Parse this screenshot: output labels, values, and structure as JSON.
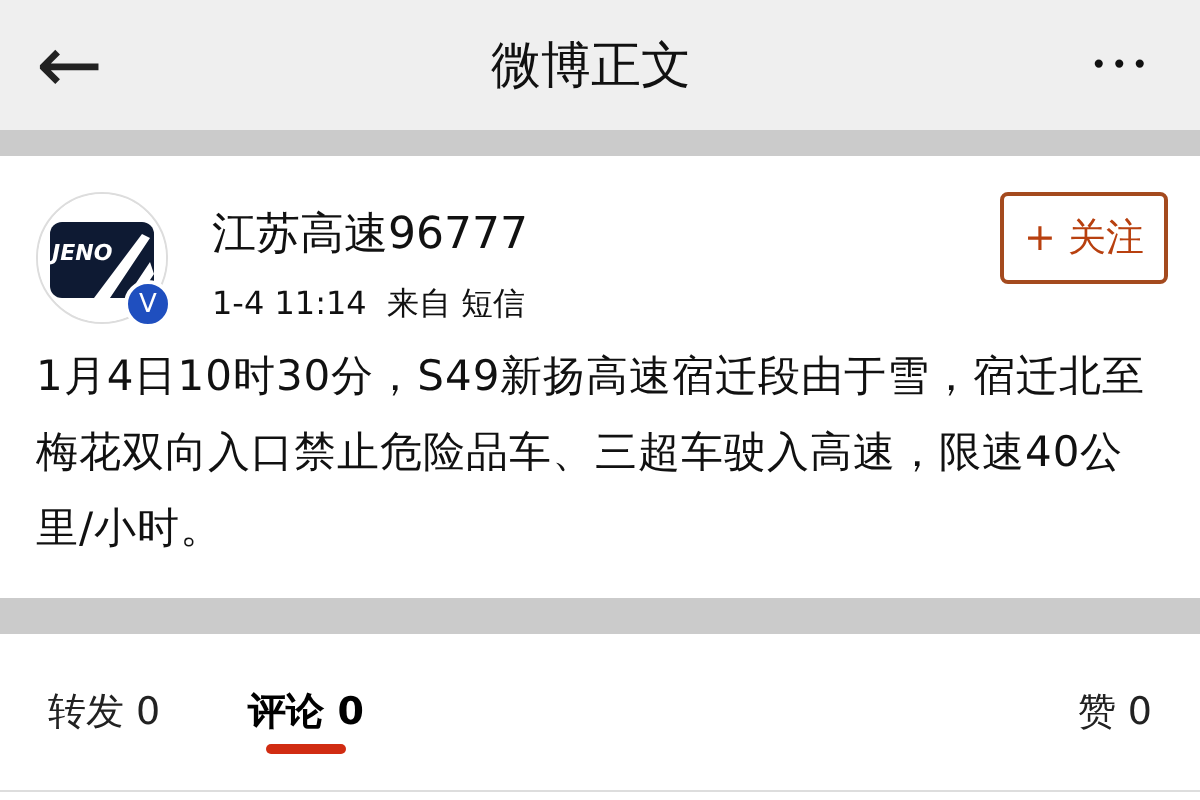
{
  "header": {
    "back": "←",
    "title": "微博正文",
    "more": "•••"
  },
  "post": {
    "avatar_text": "JENO",
    "verified": "V",
    "author": "江苏高速96777",
    "time": "1-4 11:14",
    "source": "来自 短信",
    "follow": "+ 关注",
    "body": "1月4日10时30分，S49新扬高速宿迁段由于雪，宿迁北至梅花双向入口禁止危险品车、三超车驶入高速，限速40公里/小时。"
  },
  "tabs": [
    {
      "label": "转发 0",
      "selected": false
    },
    {
      "label": "评论 0",
      "selected": true
    },
    {
      "label": "赞 0",
      "selected": false
    }
  ]
}
